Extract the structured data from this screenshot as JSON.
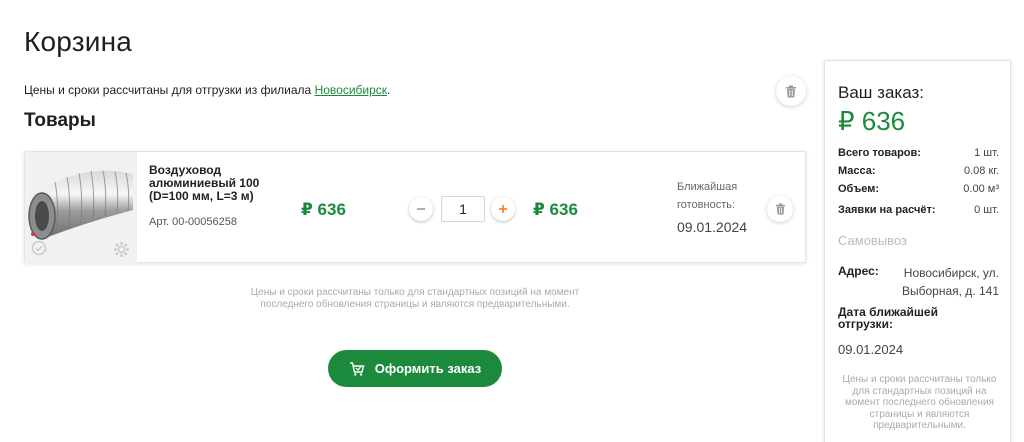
{
  "page": {
    "title": "Корзина",
    "notice_text": "Цены и сроки рассчитаны для отгрузки из филиала ",
    "notice_link": "Новосибирск",
    "notice_end": ".",
    "section_title": "Товары",
    "trash_icon": "trash-icon"
  },
  "cart": {
    "items": [
      {
        "name": "Воздуховод алюминиевый 100 (D=100 мм, L=3 м)",
        "sku": "Арт. 00-00056258",
        "price": "₽ 636",
        "quantity": "1",
        "sum": "₽ 636",
        "ready_label": "Ближайшая готовность:",
        "ready_date": "09.01.2024"
      }
    ],
    "disclaimer": "Цены и сроки рассчитаны только для стандартных позиций на момент последнего обновления страницы и являются предварительными.",
    "checkout_label": "Оформить заказ"
  },
  "summary": {
    "title": "Ваш заказ:",
    "total": "₽ 636",
    "rows": [
      {
        "k": "Всего товаров:",
        "v": "1 шт."
      },
      {
        "k": "Масса:",
        "v": "0.08 кг."
      },
      {
        "k": "Объем:",
        "v": "0.00 м³"
      },
      {
        "k": "Заявки на расчёт:",
        "v": "0 шт."
      }
    ],
    "pickup": "Самовывоз",
    "address_label": "Адрес:",
    "address_value": "Новосибирск, ул. Выборная, д. 141",
    "ship_label": "Дата ближайшей отгрузки:",
    "ship_date": "09.01.2024",
    "disclaimer": "Цены и сроки рассчитаны только для стандартных позиций на момент последнего обновления страницы и являются предварительными."
  },
  "colors": {
    "accent": "#1c8a3c",
    "plus": "#f47c20"
  }
}
